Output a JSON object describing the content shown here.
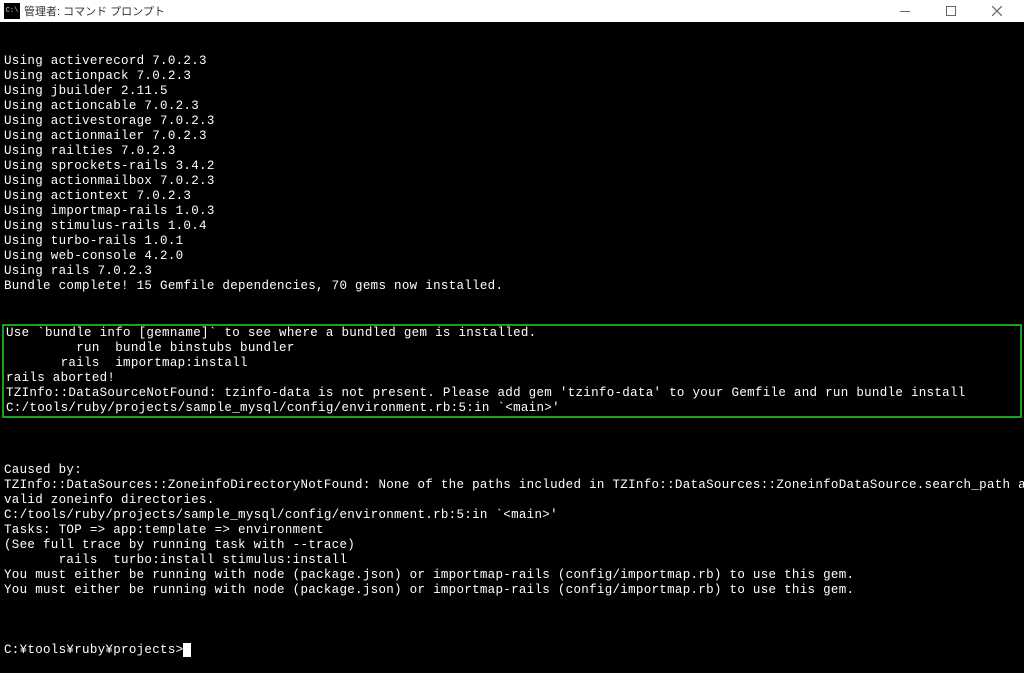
{
  "window": {
    "icon_text": "C:\\",
    "title": "管理者: コマンド プロンプト"
  },
  "terminal": {
    "lines_before": [
      "Using activerecord 7.0.2.3",
      "Using actionpack 7.0.2.3",
      "Using jbuilder 2.11.5",
      "Using actioncable 7.0.2.3",
      "Using activestorage 7.0.2.3",
      "Using actionmailer 7.0.2.3",
      "Using railties 7.0.2.3",
      "Using sprockets-rails 3.4.2",
      "Using actionmailbox 7.0.2.3",
      "Using actiontext 7.0.2.3",
      "Using importmap-rails 1.0.3",
      "Using stimulus-rails 1.0.4",
      "Using turbo-rails 1.0.1",
      "Using web-console 4.2.0",
      "Using rails 7.0.2.3",
      "Bundle complete! 15 Gemfile dependencies, 70 gems now installed."
    ],
    "highlighted": [
      "Use `bundle info [gemname]` to see where a bundled gem is installed.",
      "         run  bundle binstubs bundler",
      "       rails  importmap:install",
      "rails aborted!",
      "TZInfo::DataSourceNotFound: tzinfo-data is not present. Please add gem 'tzinfo-data' to your Gemfile and run bundle install",
      "C:/tools/ruby/projects/sample_mysql/config/environment.rb:5:in `<main>'"
    ],
    "lines_after": [
      "",
      "Caused by:",
      "TZInfo::DataSources::ZoneinfoDirectoryNotFound: None of the paths included in TZInfo::DataSources::ZoneinfoDataSource.search_path are",
      "valid zoneinfo directories.",
      "C:/tools/ruby/projects/sample_mysql/config/environment.rb:5:in `<main>'",
      "Tasks: TOP => app:template => environment",
      "(See full trace by running task with --trace)",
      "       rails  turbo:install stimulus:install",
      "You must either be running with node (package.json) or importmap-rails (config/importmap.rb) to use this gem.",
      "You must either be running with node (package.json) or importmap-rails (config/importmap.rb) to use this gem.",
      ""
    ],
    "prompt": "C:¥tools¥ruby¥projects>"
  }
}
